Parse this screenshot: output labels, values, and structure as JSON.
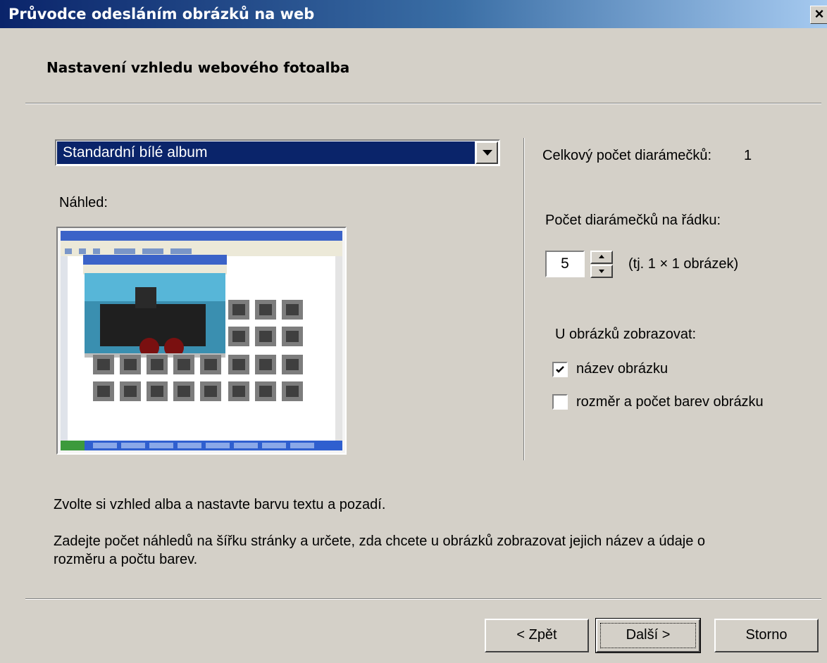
{
  "window": {
    "title": "Průvodce odesláním obrázků na web",
    "close_glyph": "×"
  },
  "page": {
    "heading": "Nastavení vzhledu webového fotoalba"
  },
  "layout_select": {
    "value": "Standardní bílé album"
  },
  "preview": {
    "label": "Náhled:",
    "image": "web-album-preview-thumbnail"
  },
  "stats": {
    "total_label": "Celkový počet diarámečků:",
    "total_value": "1"
  },
  "per_row": {
    "label": "Počet diarámečků na řádku:",
    "value": "5",
    "hint": "(tj. 1 × 1 obrázek)"
  },
  "display": {
    "label": "U obrázků zobrazovat:",
    "options": [
      {
        "label": "název obrázku",
        "checked": true
      },
      {
        "label": "rozměr a počet barev obrázku",
        "checked": false
      }
    ]
  },
  "info": {
    "line1": "Zvolte si vzhled alba a nastavte barvu textu a pozadí.",
    "line2a": "Zadejte počet náhledů na šířku stránky a určete, zda chcete u obrázků zobrazovat jejich název a údaje o",
    "line2b": "rozměru a počtu barev."
  },
  "buttons": {
    "back": "< Zpět",
    "next": "Další >",
    "cancel": "Storno"
  }
}
